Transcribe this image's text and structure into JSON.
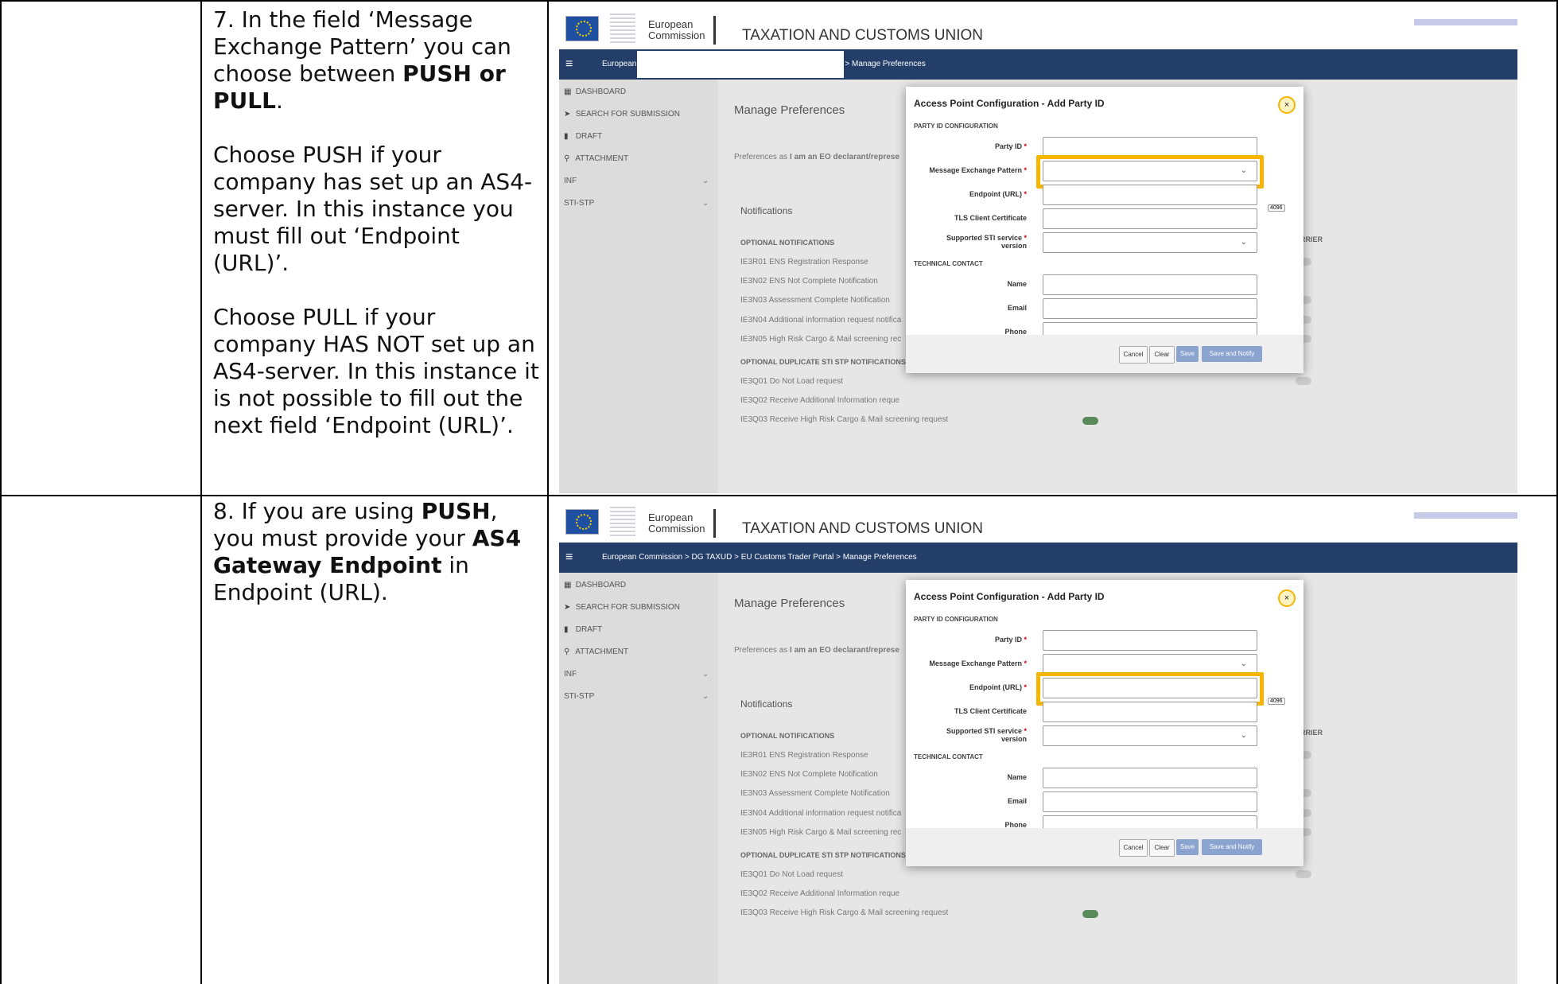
{
  "rows": [
    {
      "text": {
        "p1": [
          "7. In the field ‘Message Exchange Pattern’ you can choose between ",
          "PUSH or PULL",
          "."
        ],
        "p2": "Choose PUSH if your company has set up an AS4-server. In this instance you must fill out ‘Endpoint (URL)’.",
        "p3": "Choose PULL if your company HAS NOT set up an AS4-server. In this instance it is not possible to fill out the next field ‘Endpoint (URL)’."
      },
      "breadcrumb": [
        "European",
        "> Manage Preferences"
      ],
      "highlight_field": "message_exchange_pattern"
    },
    {
      "text": {
        "p1": [
          "8. If you are using ",
          "PUSH",
          ", you must provide your ",
          "AS4 Gateway Endpoint",
          " in Endpoint (URL)."
        ]
      },
      "breadcrumb": [
        "European Commission > DG TAXUD > EU Customs Trader Portal > Manage Preferences"
      ],
      "highlight_field": "endpoint_url"
    }
  ],
  "app": {
    "logo_line1": "European",
    "logo_line2": "Commission",
    "site_title": "TAXATION AND CUSTOMS UNION",
    "menu_icon": "≡",
    "sidebar": [
      {
        "label": "DASHBOARD",
        "icon": "dashboard-icon",
        "glyph": "▦"
      },
      {
        "label": "SEARCH FOR SUBMISSION",
        "icon": "arrow-icon",
        "glyph": "➤"
      },
      {
        "label": "DRAFT",
        "icon": "document-icon",
        "glyph": "▮"
      },
      {
        "label": "ATTACHMENT",
        "icon": "attachment-icon",
        "glyph": "⚲"
      },
      {
        "label": "INF",
        "icon": "",
        "glyph": ""
      },
      {
        "label": "STI-STP",
        "icon": "",
        "glyph": ""
      }
    ],
    "page_title": "Manage Preferences",
    "preferences_as": "Preferences as",
    "preferences_role": "I am an EO declarant/represe",
    "notifications": "Notifications",
    "optional_notifications": "OPTIONAL NOTIFICATIONS",
    "as_carrier": "AS CARRIER",
    "notification_rows": [
      "IE3R01 ENS Registration Response",
      "IE3N02 ENS Not Complete Notification",
      "IE3N03 Assessment Complete Notification",
      "IE3N04 Additional information request notifica",
      "IE3N05 High Risk Cargo & Mail screening rec"
    ],
    "optional_duplicate": "OPTIONAL DUPLICATE STI STP NOTIFICATIONS",
    "duplicate_rows": [
      "IE3Q01 Do Not Load request",
      "IE3Q02 Receive Additional Information reque",
      "IE3Q03 Receive High Risk Cargo & Mail screening request"
    ],
    "modal": {
      "title": "Access Point Configuration - Add Party ID",
      "close": "×",
      "section_party": "PARTY ID CONFIGURATION",
      "party_id": "Party ID",
      "message_exchange_pattern": "Message Exchange Pattern",
      "endpoint": "Endpoint (URL)",
      "tls": "TLS Client Certificate",
      "tls_badge": "4096",
      "sti_version_1": "Supported STI service",
      "sti_version_2": "version",
      "section_tech": "TECHNICAL CONTACT",
      "name": "Name",
      "email": "Email",
      "phone": "Phone",
      "required_mark": "*",
      "select_arrow": "⌄",
      "buttons": {
        "cancel": "Cancel",
        "clear": "Clear",
        "save": "Save",
        "save_notify": "Save and Notify"
      }
    }
  },
  "colors": {
    "bluebar": "#243e6a",
    "highlight": "#f7b500"
  }
}
